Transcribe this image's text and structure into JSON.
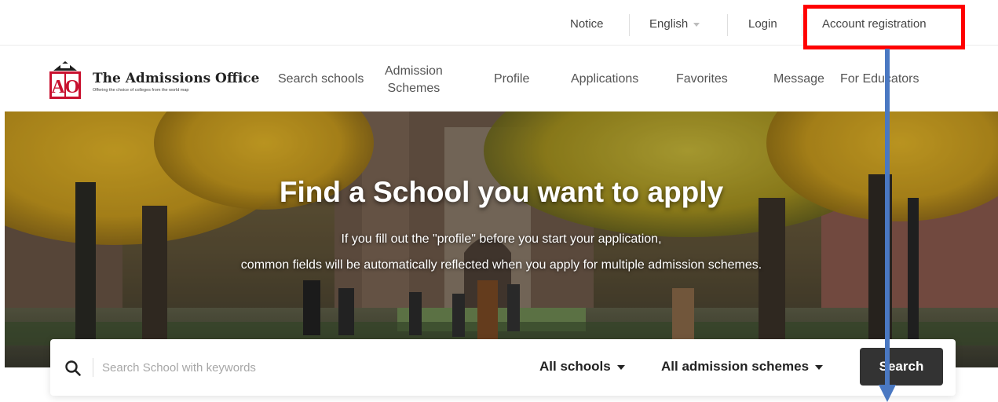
{
  "topbar": {
    "notice": "Notice",
    "language": "English",
    "login": "Login",
    "account_registration": "Account registration"
  },
  "brand": {
    "logo_letters": "AO",
    "name": "The Admissions Office",
    "tagline": "Offering the choice of colleges from the world map"
  },
  "nav": {
    "search_schools": "Search schools",
    "admission_schemes_line1": "Admission",
    "admission_schemes_line2": "Schemes",
    "profile": "Profile",
    "applications": "Applications",
    "favorites": "Favorites",
    "message": "Message",
    "for_educators": "For Educators"
  },
  "hero": {
    "title": "Find a School you want to apply",
    "subtitle_line1": "If you fill out the \"profile\" before you start your application,",
    "subtitle_line2": "common fields will be automatically reflected when you apply for multiple admission schemes."
  },
  "search": {
    "placeholder": "Search School with keywords",
    "value": "",
    "schools_filter": "All schools",
    "schemes_filter": "All admission schemes",
    "button": "Search"
  },
  "colors": {
    "highlight": "#ff0000",
    "annotation_arrow": "#4a78c2",
    "logo_red": "#c8102e",
    "search_button": "#333333"
  },
  "icons": [
    "search-icon",
    "chevron-down-icon",
    "arrow-down-icon"
  ]
}
